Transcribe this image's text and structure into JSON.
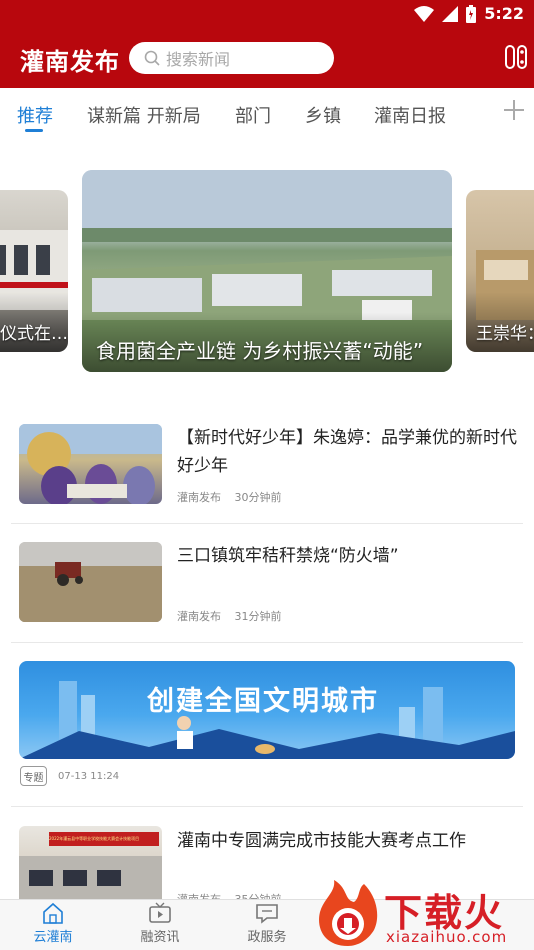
{
  "status": {
    "time": "5:22"
  },
  "header": {
    "title": "灌南发布",
    "search_placeholder": "搜索新闻"
  },
  "tabs": [
    {
      "label": "推荐",
      "active": true
    },
    {
      "label": "谋新篇 开新局",
      "active": false
    },
    {
      "label": "部门",
      "active": false
    },
    {
      "label": "乡镇",
      "active": false
    },
    {
      "label": "灌南日报",
      "active": false
    }
  ],
  "carousel": {
    "left_caption": "仪式在…",
    "main_caption": "食用菌全产业链 为乡村振兴蓄“动能”",
    "right_caption": "王崇华："
  },
  "news": [
    {
      "title": "【新时代好少年】朱逸婷：品学兼优的新时代好少年",
      "source": "灌南发布",
      "time": "30分钟前"
    },
    {
      "title": "三口镇筑牢秸秆禁烧“防火墙”",
      "source": "灌南发布",
      "time": "31分钟前"
    }
  ],
  "special": {
    "banner_text": "创建全国文明城市",
    "badge": "专题",
    "time": "07-13 11:24"
  },
  "news_last": {
    "title": "灌南中专圆满完成市技能大赛考点工作",
    "source": "灌南发布",
    "time": "35分钟前",
    "thumb_sign": "2022年灌云县中等职业学校技能大赛会计技能项目"
  },
  "bottom_nav": [
    {
      "label": "云灌南",
      "icon": "home-icon",
      "active": true
    },
    {
      "label": "融资讯",
      "icon": "tv-icon",
      "active": false
    },
    {
      "label": "政服务",
      "icon": "chat-icon",
      "active": false
    }
  ],
  "watermark": {
    "text": "下载火",
    "sub": "xiazaihuo.com"
  },
  "colors": {
    "brand_red": "#b8070d",
    "accent_blue": "#1f7fd6"
  }
}
